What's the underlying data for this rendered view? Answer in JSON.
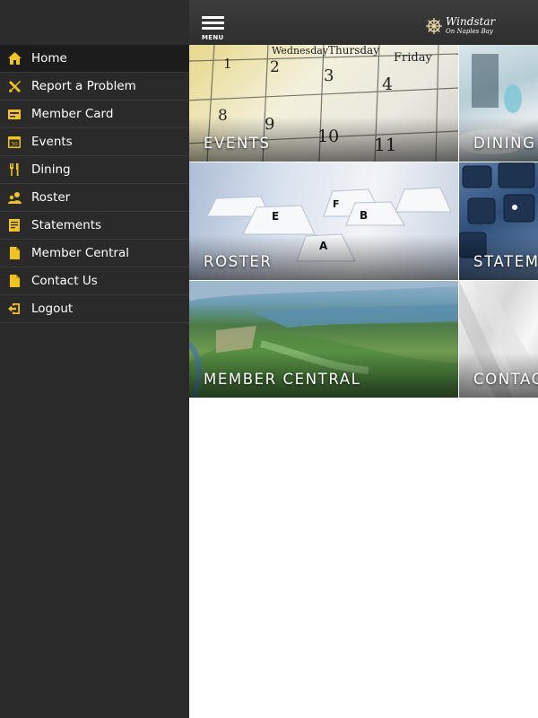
{
  "menu": {
    "items": [
      {
        "label": "Home",
        "icon": "home-icon",
        "active": true
      },
      {
        "label": "Report a Problem",
        "icon": "tools-icon"
      },
      {
        "label": "Member Card",
        "icon": "card-icon"
      },
      {
        "label": "Events",
        "icon": "calendar-icon"
      },
      {
        "label": "Dining",
        "icon": "fork-knife-icon"
      },
      {
        "label": "Roster",
        "icon": "people-icon"
      },
      {
        "label": "Statements",
        "icon": "statement-icon"
      },
      {
        "label": "Member Central",
        "icon": "document-icon"
      },
      {
        "label": "Contact Us",
        "icon": "document-icon"
      },
      {
        "label": "Logout",
        "icon": "logout-icon"
      }
    ]
  },
  "header": {
    "menu_label": "MENU",
    "logo_line1": "Windstar",
    "logo_line2": "On Naples Bay"
  },
  "calendar": {
    "days": [
      "Wednesday",
      "Thursday",
      "Friday"
    ],
    "numbers": [
      "1",
      "2",
      "3",
      "4",
      "8",
      "9",
      "10",
      "11"
    ]
  },
  "roster_tabs": [
    "E",
    "F",
    "B",
    "A"
  ],
  "tiles": {
    "events": "EVENTS",
    "dining": "DINING",
    "roster": "ROSTER",
    "statements": "STATEM",
    "member_central": "MEMBER CENTRAL",
    "contact": "CONTAC"
  },
  "colors": {
    "accent": "#f0c419",
    "sidebar_bg": "#2a2a2a",
    "topbar_bg": "#353535"
  }
}
